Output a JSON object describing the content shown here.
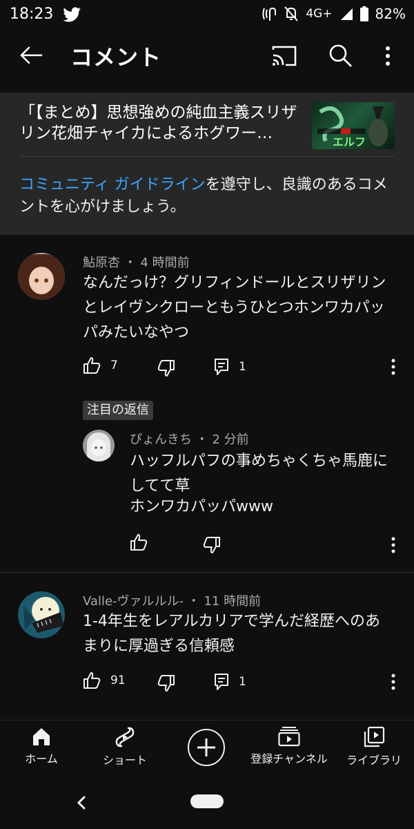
{
  "status": {
    "time": "18:23",
    "network": "4G+",
    "battery": "82%",
    "icons": [
      "twitter-icon",
      "nfc-icon",
      "mute-icon",
      "signal-icon",
      "battery-icon"
    ]
  },
  "header": {
    "title": "コメント",
    "icons": [
      "back-arrow-icon",
      "cast-icon",
      "search-icon",
      "more-vert-icon"
    ]
  },
  "video": {
    "title": "「【まとめ】思想強めの純血主義スリザリン花畑チャイカによるホグワー…",
    "thumbnail_text": "エルフ"
  },
  "guideline": {
    "link_text": "コミュニティ ガイドライン",
    "rest_text": "を遵守し、良識のあるコメントを心がけましょう。"
  },
  "comments": [
    {
      "author": "鮎原杏",
      "time": "4 時間前",
      "text": "なんだっけ？グリフィンドールとスリザリンとレイヴンクローともうひとつホンワカパッパみたいなやつ",
      "likes": "7",
      "replies": "1"
    },
    {
      "author": "Valle-ヴァルルル-",
      "time": "11 時間前",
      "text": "1-4年生をレアルカリアで学んだ経歴へのあまりに厚過ぎる信頼感",
      "likes": "91",
      "replies": "1"
    }
  ],
  "featured_reply": {
    "label": "注目の返信",
    "author": "ぴょんきち",
    "time": "2 分前",
    "line1": "ハッフルパフの事めちゃくちゃ馬鹿にしてて草",
    "line2": "ホンワカパッパwww"
  },
  "bottom_nav": {
    "items": [
      {
        "label": "ホーム",
        "icon": "home-icon"
      },
      {
        "label": "ショート",
        "icon": "shorts-icon"
      },
      {
        "label": "",
        "icon": "create-plus-icon"
      },
      {
        "label": "登録チャンネル",
        "icon": "subscriptions-icon"
      },
      {
        "label": "ライブラリ",
        "icon": "library-icon"
      }
    ]
  },
  "colors": {
    "background": "#0f0f0f",
    "card": "#272727",
    "link": "#3ea6ff",
    "meta": "#aaaaaa"
  }
}
